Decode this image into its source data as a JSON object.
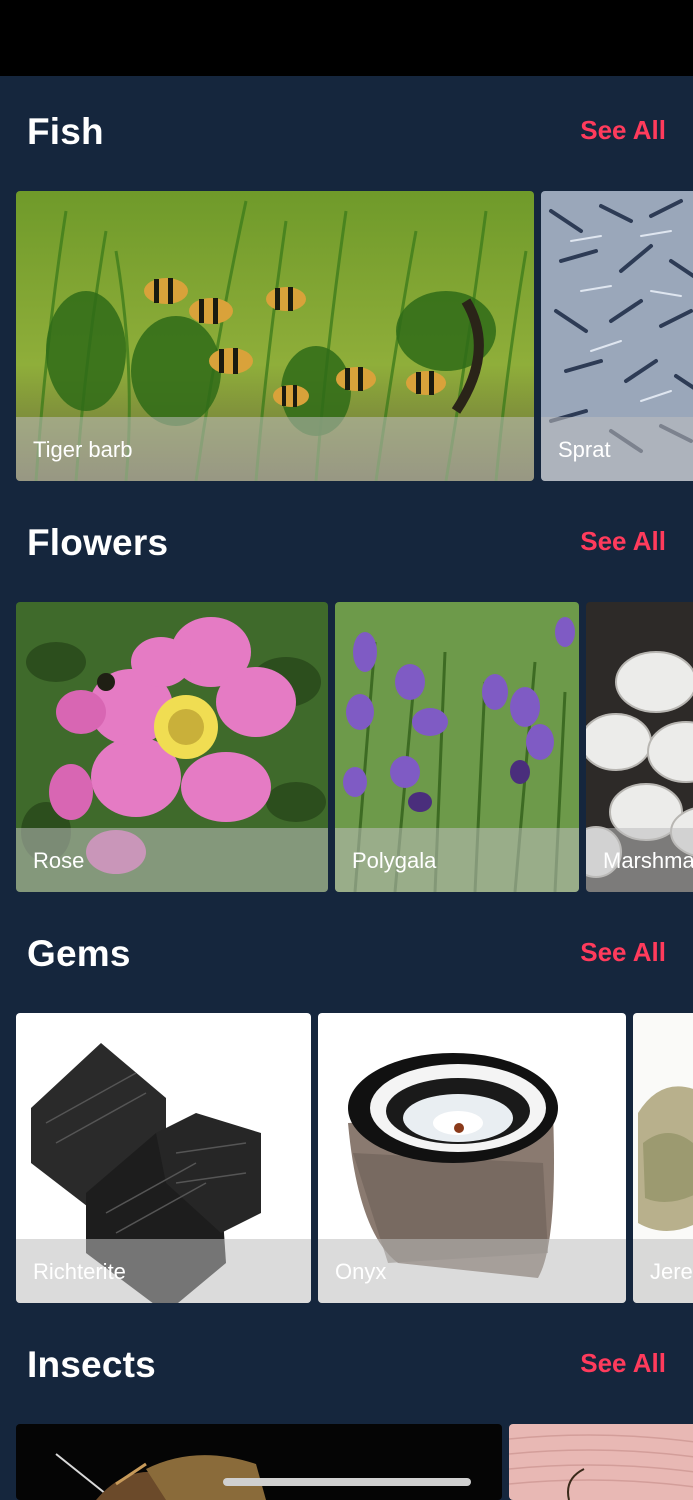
{
  "sections": [
    {
      "title": "Fish",
      "see_all": "See All",
      "items": [
        {
          "label": "Tiger barb"
        },
        {
          "label": "Sprat"
        }
      ]
    },
    {
      "title": "Flowers",
      "see_all": "See All",
      "items": [
        {
          "label": "Rose"
        },
        {
          "label": "Polygala"
        },
        {
          "label": "Marshma"
        }
      ]
    },
    {
      "title": "Gems",
      "see_all": "See All",
      "items": [
        {
          "label": "Richterite"
        },
        {
          "label": "Onyx"
        },
        {
          "label": "Jere"
        }
      ]
    },
    {
      "title": "Insects",
      "see_all": "See All",
      "items": [
        {
          "label": ""
        },
        {
          "label": ""
        }
      ]
    }
  ],
  "colors": {
    "background": "#15263d",
    "accent": "#ff3b5c",
    "status_bar": "#000000"
  }
}
